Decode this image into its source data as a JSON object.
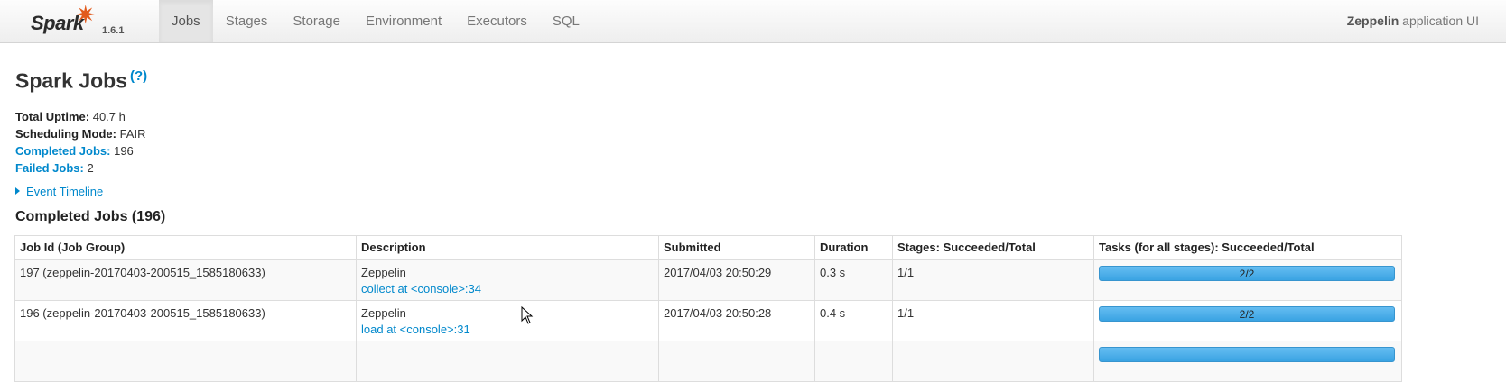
{
  "navbar": {
    "brand": "Spark",
    "version": "1.6.1",
    "tabs": [
      {
        "label": "Jobs",
        "active": true
      },
      {
        "label": "Stages",
        "active": false
      },
      {
        "label": "Storage",
        "active": false
      },
      {
        "label": "Environment",
        "active": false
      },
      {
        "label": "Executors",
        "active": false
      },
      {
        "label": "SQL",
        "active": false
      }
    ],
    "app_name": "Zeppelin",
    "app_suffix": " application UI"
  },
  "page": {
    "title": "Spark Jobs",
    "help": "(?)",
    "summary": {
      "uptime_label": "Total Uptime:",
      "uptime_value": "40.7 h",
      "mode_label": "Scheduling Mode:",
      "mode_value": "FAIR",
      "completed_label": "Completed Jobs:",
      "completed_value": "196",
      "failed_label": "Failed Jobs:",
      "failed_value": "2"
    },
    "timeline_label": "Event Timeline",
    "section_title": "Completed Jobs (196)"
  },
  "table": {
    "headers": [
      "Job Id (Job Group)",
      "Description",
      "Submitted",
      "Duration",
      "Stages: Succeeded/Total",
      "Tasks (for all stages): Succeeded/Total"
    ],
    "rows": [
      {
        "job_id": "197 (zeppelin-20170403-200515_1585180633)",
        "desc_group": "Zeppelin",
        "desc_link": "collect at <console>:34",
        "submitted": "2017/04/03 20:50:29",
        "duration": "0.3 s",
        "stages": "1/1",
        "tasks": "2/2",
        "task_fraction": 1.0
      },
      {
        "job_id": "196 (zeppelin-20170403-200515_1585180633)",
        "desc_group": "Zeppelin",
        "desc_link": "load at <console>:31",
        "submitted": "2017/04/03 20:50:28",
        "duration": "0.4 s",
        "stages": "1/1",
        "tasks": "2/2",
        "task_fraction": 1.0
      }
    ]
  }
}
